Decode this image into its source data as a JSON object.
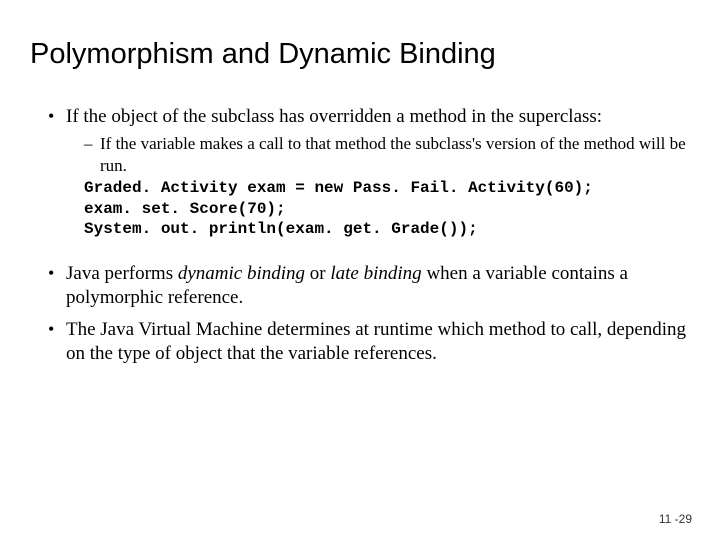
{
  "title": "Polymorphism and Dynamic Binding",
  "bullet1": "If the object of the subclass has overridden a method in the superclass:",
  "sub1": "If the variable makes a call to that method the subclass's version of the method will be run.",
  "code": "Graded. Activity exam = new Pass. Fail. Activity(60);\nexam. set. Score(70);\nSystem. out. println(exam. get. Grade());",
  "bullet2_pre": "Java performs ",
  "bullet2_dyn": "dynamic binding",
  "bullet2_or": " or ",
  "bullet2_late": "late binding",
  "bullet2_post": " when a variable contains a polymorphic reference.",
  "bullet3": "The Java Virtual Machine determines at runtime which method to call, depending on the type of object that the variable references.",
  "page": "11 -29"
}
